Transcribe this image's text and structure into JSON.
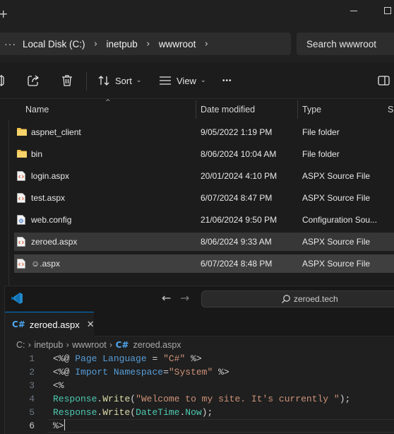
{
  "explorer": {
    "new_tab_glyph": "+",
    "address": {
      "more": "···",
      "crumbs": [
        "Local Disk (C:)",
        "inetpub",
        "wwwroot"
      ],
      "chevron": "›"
    },
    "search_placeholder": "Search wwwroot",
    "toolbar": {
      "sort_label": "Sort",
      "view_label": "View",
      "more": "•••",
      "caret": "⌄"
    },
    "columns": {
      "name": "Name",
      "date": "Date modified",
      "type": "Type",
      "size": "Size"
    },
    "files": [
      {
        "name": "aspnet_client",
        "date": "9/05/2022 1:19 PM",
        "type": "File folder",
        "icon": "folder-icon"
      },
      {
        "name": "bin",
        "date": "8/06/2024 10:04 AM",
        "type": "File folder",
        "icon": "folder-icon"
      },
      {
        "name": "login.aspx",
        "date": "20/01/2024 4:10 PM",
        "type": "ASPX Source File",
        "icon": "aspx-file-icon"
      },
      {
        "name": "test.aspx",
        "date": "6/07/2024 8:47 PM",
        "type": "ASPX Source File",
        "icon": "aspx-file-icon"
      },
      {
        "name": "web.config",
        "date": "21/06/2024 9:50 PM",
        "type": "Configuration Sou...",
        "icon": "config-file-icon"
      },
      {
        "name": "zeroed.aspx",
        "date": "8/06/2024 9:33 AM",
        "type": "ASPX Source File",
        "icon": "aspx-file-icon"
      },
      {
        "name": "☺.aspx",
        "date": "6/07/2024 8:48 PM",
        "type": "ASPX Source File",
        "icon": "aspx-file-icon"
      }
    ]
  },
  "vscode": {
    "nav_back": "←",
    "nav_forward": "→",
    "command_center": "zeroed.tech",
    "tab": {
      "lang_glyph": "C#",
      "label": "zeroed.aspx",
      "close": "✕"
    },
    "breadcrumb": [
      "C:",
      "inetpub",
      "wwwroot",
      "zeroed.aspx"
    ],
    "breadcrumb_sep": "›",
    "lines": [
      {
        "n": "1",
        "tokens": [
          [
            "plain",
            "<%@ "
          ],
          [
            "kw",
            "Page"
          ],
          [
            "plain",
            " "
          ],
          [
            "kw",
            "Language"
          ],
          [
            "plain",
            " = "
          ],
          [
            "str",
            "\"C#\""
          ],
          [
            "plain",
            " %>"
          ]
        ]
      },
      {
        "n": "2",
        "tokens": [
          [
            "plain",
            "<%@ "
          ],
          [
            "kw",
            "Import"
          ],
          [
            "plain",
            " "
          ],
          [
            "kw",
            "Namespace"
          ],
          [
            "plain",
            "="
          ],
          [
            "str",
            "\"System\""
          ],
          [
            "plain",
            " %>"
          ]
        ]
      },
      {
        "n": "3",
        "tokens": [
          [
            "plain",
            "<%"
          ]
        ]
      },
      {
        "n": "4",
        "tokens": [
          [
            "id",
            "Response"
          ],
          [
            "plain",
            "."
          ],
          [
            "fn",
            "Write"
          ],
          [
            "plain",
            "("
          ],
          [
            "str",
            "\"Welcome to my site. It's currently \""
          ],
          [
            "plain",
            ");"
          ]
        ]
      },
      {
        "n": "5",
        "tokens": [
          [
            "id",
            "Response"
          ],
          [
            "plain",
            "."
          ],
          [
            "fn",
            "Write"
          ],
          [
            "plain",
            "("
          ],
          [
            "id",
            "DateTime"
          ],
          [
            "plain",
            "."
          ],
          [
            "id",
            "Now"
          ],
          [
            "plain",
            ");"
          ]
        ]
      },
      {
        "n": "6",
        "tokens": [
          [
            "plain",
            "%>"
          ]
        ]
      }
    ],
    "current_line": "6"
  },
  "colors": {
    "accent": "#0078d4",
    "folder": "#f2c14e",
    "keyword": "#569cd6",
    "string": "#ce9178",
    "identifier": "#4ec9b0",
    "function": "#dcdcaa"
  }
}
